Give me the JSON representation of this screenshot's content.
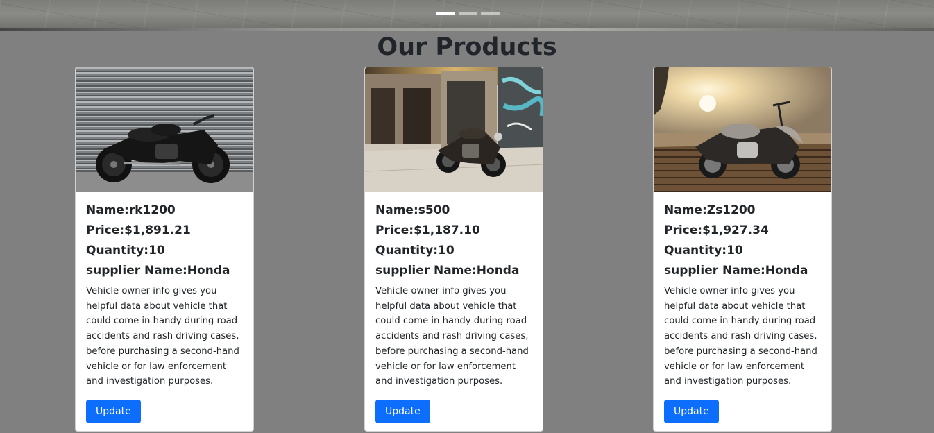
{
  "carousel": {
    "slide_count": 3,
    "active_index": 0
  },
  "section": {
    "title": "Our Products"
  },
  "products": [
    {
      "image_icon": "motorcycle-against-shutter",
      "name_line": "Name:rk1200",
      "price_line": "Price:$1,891.21",
      "quantity_line": "Quantity:10",
      "supplier_line": "supplier Name:Honda",
      "description": "Vehicle owner info gives you helpful data about vehicle that could come in handy during road accidents and rash driving cases, before purchasing a second-hand vehicle or for law enforcement and investigation purposes.",
      "button_label": "Update"
    },
    {
      "image_icon": "motorcycle-graffiti-street",
      "name_line": "Name:s500",
      "price_line": "Price:$1,187.10",
      "quantity_line": "Quantity:10",
      "supplier_line": "supplier Name:Honda",
      "description": "Vehicle owner info gives you helpful data about vehicle that could come in handy during road accidents and rash driving cases, before purchasing a second-hand vehicle or for law enforcement and investigation purposes.",
      "button_label": "Update"
    },
    {
      "image_icon": "motorcycle-sunset-boardwalk",
      "name_line": "Name:Zs1200",
      "price_line": "Price:$1,927.34",
      "quantity_line": "Quantity:10",
      "supplier_line": "supplier Name:Honda",
      "description": "Vehicle owner info gives you helpful data about vehicle that could come in handy during road accidents and rash driving cases, before purchasing a second-hand vehicle or for law enforcement and investigation purposes.",
      "button_label": "Update"
    }
  ],
  "colors": {
    "page_background": "#808080",
    "button_primary": "#0d6efd",
    "text_dark": "#212529"
  }
}
